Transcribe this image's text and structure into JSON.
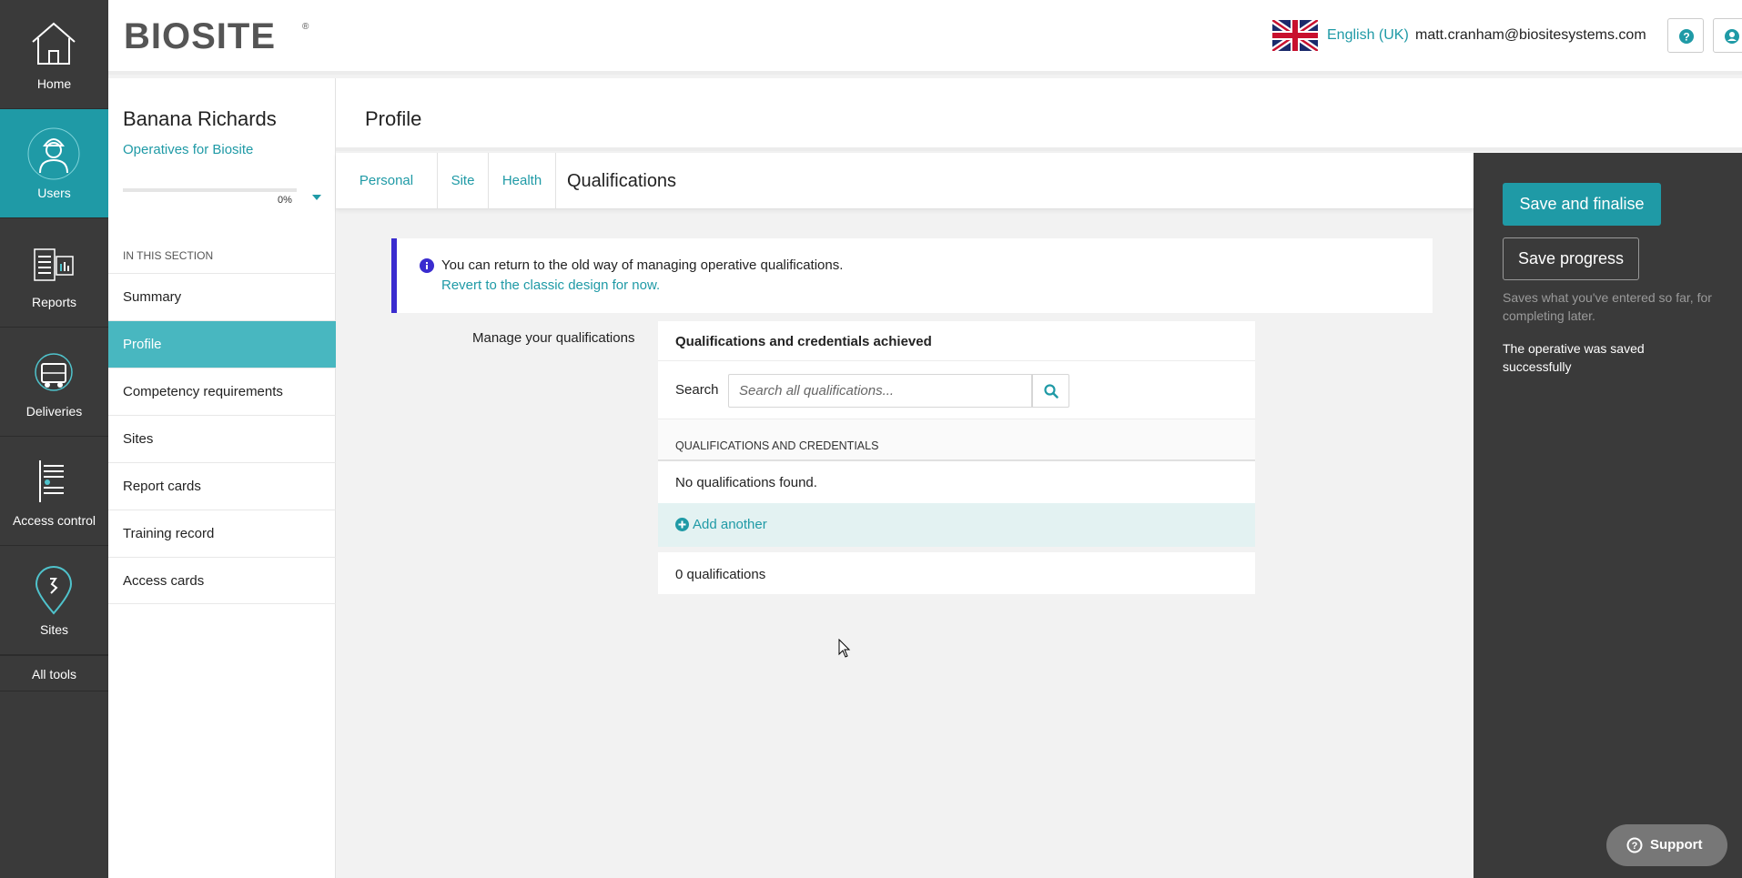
{
  "rail": {
    "items": [
      {
        "label": "Home",
        "icon": "home-icon"
      },
      {
        "label": "Users",
        "icon": "user-worker-icon"
      },
      {
        "label": "Reports",
        "icon": "reports-icon"
      },
      {
        "label": "Deliveries",
        "icon": "truck-icon"
      },
      {
        "label": "Access control",
        "icon": "turnstile-icon"
      },
      {
        "label": "Sites",
        "icon": "map-pin-icon"
      }
    ],
    "all_tools": "All tools"
  },
  "topbar": {
    "logo": "BIOSITE",
    "language": "English (UK)",
    "email": "matt.cranham@biositesystems.com"
  },
  "subnav": {
    "name": "Banana Richards",
    "org": "Operatives for Biosite",
    "progress_percent": 0,
    "progress_text": "0%",
    "section_heading": "IN THIS SECTION",
    "items": [
      "Summary",
      "Profile",
      "Competency requirements",
      "Sites",
      "Report cards",
      "Training record",
      "Access cards"
    ]
  },
  "page": {
    "title": "Profile",
    "tabs": [
      "Personal",
      "Site",
      "Health"
    ],
    "current_tab": "Qualifications"
  },
  "notice": {
    "text": "You can return to the old way of managing operative qualifications.",
    "link": "Revert to the classic design for now."
  },
  "qualifications": {
    "manage_label": "Manage your qualifications",
    "card_title": "Qualifications and credentials achieved",
    "search_label": "Search",
    "search_placeholder": "Search all qualifications...",
    "column_header": "QUALIFICATIONS AND CREDENTIALS",
    "empty_message": "No qualifications found.",
    "add_label": "Add another",
    "count_text": "0 qualifications"
  },
  "actions": {
    "save_final": "Save and finalise",
    "save_progress": "Save progress",
    "save_hint": "Saves what you've entered so far, for completing later.",
    "status": "The operative was saved successfully"
  },
  "support": "Support",
  "colors": {
    "accent": "#1f9aa6",
    "rail": "#3a3a3a",
    "notice_border": "#3a2ccf"
  }
}
